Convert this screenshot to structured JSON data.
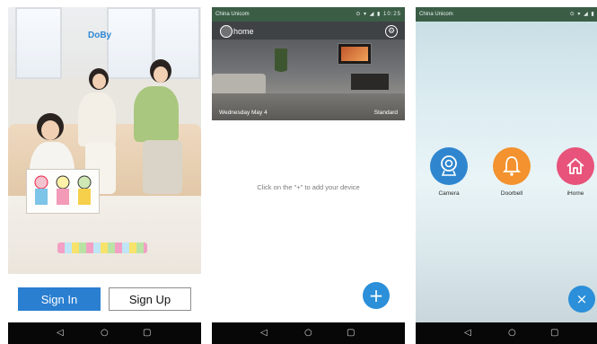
{
  "screens": [
    {
      "status": {
        "carrier": "",
        "icons": ""
      },
      "logo": "DoBy",
      "signin_label": "Sign In",
      "signup_label": "Sign Up"
    },
    {
      "status": {
        "carrier": "China Unicom",
        "icons": "⊙ ▾ ◢ ▮ 10:25"
      },
      "home_label": "home",
      "date": "Wednesday May 4",
      "mode": "Standard",
      "empty_hint": "Click on the \"+\" to add your device",
      "fab_icon": "+"
    },
    {
      "status": {
        "carrier": "China Unicom",
        "icons": "⊙ ▾ ◢ ▮ 10"
      },
      "devices": [
        {
          "label": "Camera",
          "icon": "camera-icon",
          "color": "#2f86cf"
        },
        {
          "label": "Doorbell",
          "icon": "bell-icon",
          "color": "#f3922e"
        },
        {
          "label": "iHome",
          "icon": "home-icon",
          "color": "#e7537a"
        }
      ],
      "close_icon": "×"
    }
  ],
  "navbar": {
    "back": "◁",
    "home": "○",
    "recent": "▢"
  },
  "colors": {
    "primary": "#2a7fd0",
    "accent_orange": "#f3922e",
    "accent_pink": "#e7537a"
  }
}
